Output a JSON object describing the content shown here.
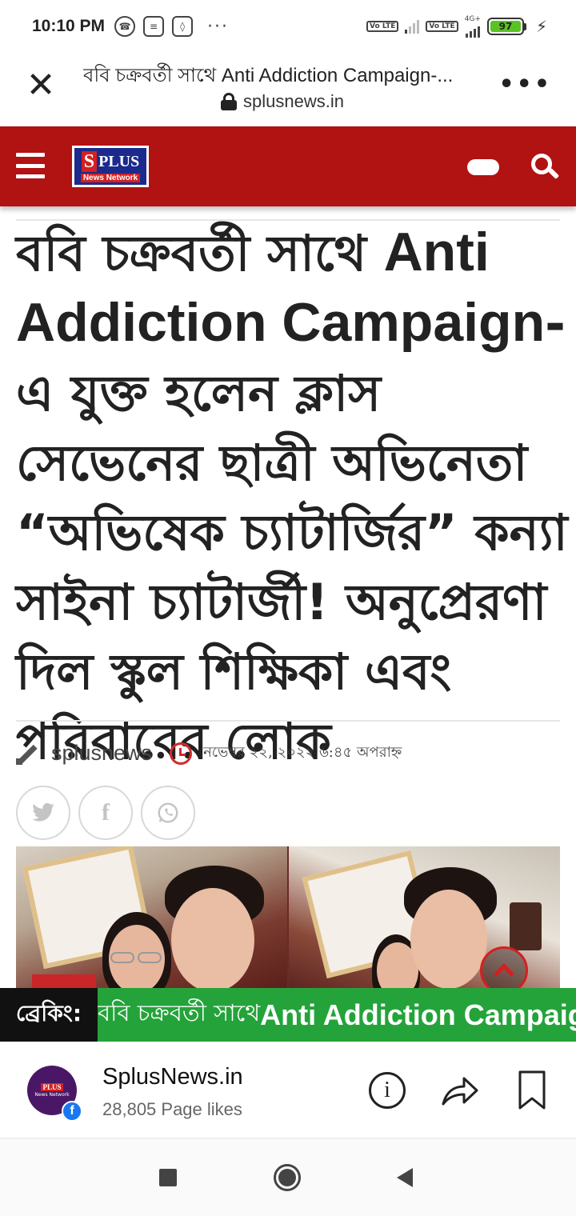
{
  "status_bar": {
    "time": "10:10 PM",
    "dots": "···",
    "network_1": "Vo LTE",
    "network_2": "Vo LTE",
    "network_type": "4G+",
    "battery": "97"
  },
  "browser": {
    "title": "ববি চক্রবর্তী সাথে Anti Addiction Campaign-...",
    "url": "splusnews.in"
  },
  "site": {
    "logo_main": "PLUS",
    "logo_s": "S",
    "logo_sub": "News Network",
    "colors": {
      "header": "#b11212",
      "ticker": "#24a33a"
    }
  },
  "article": {
    "headline_bn1": "ববি চক্রবর্তী সাথে ",
    "headline_en": "Anti Addiction Campaign",
    "headline_bn2": "-এ যুক্ত হলেন ক্লাস সেভেনের ছাত্রী অভিনেতা “অভিষেক চ্যাটার্জির” কন্যা সাইনা চ্যাটার্জী! অনুপ্রেরণা দিল স্কুল শিক্ষিকা এবং পরিবারের লোক",
    "author": "splusnews",
    "date": "নভেম্বর ২২, ২০২২ ৬:৪৫ অপরাহ্ন",
    "share_icons": [
      "twitter-icon",
      "facebook-icon",
      "whatsapp-icon"
    ]
  },
  "ticker": {
    "label": "ব্রেকিং:",
    "text_bn": "ববি চক্রবর্তী সাথে ",
    "text_en": "Anti Addiction Campaign"
  },
  "facebook_bar": {
    "page_name": "SplusNews.in",
    "likes": "28,805 Page likes",
    "badge": "f"
  }
}
